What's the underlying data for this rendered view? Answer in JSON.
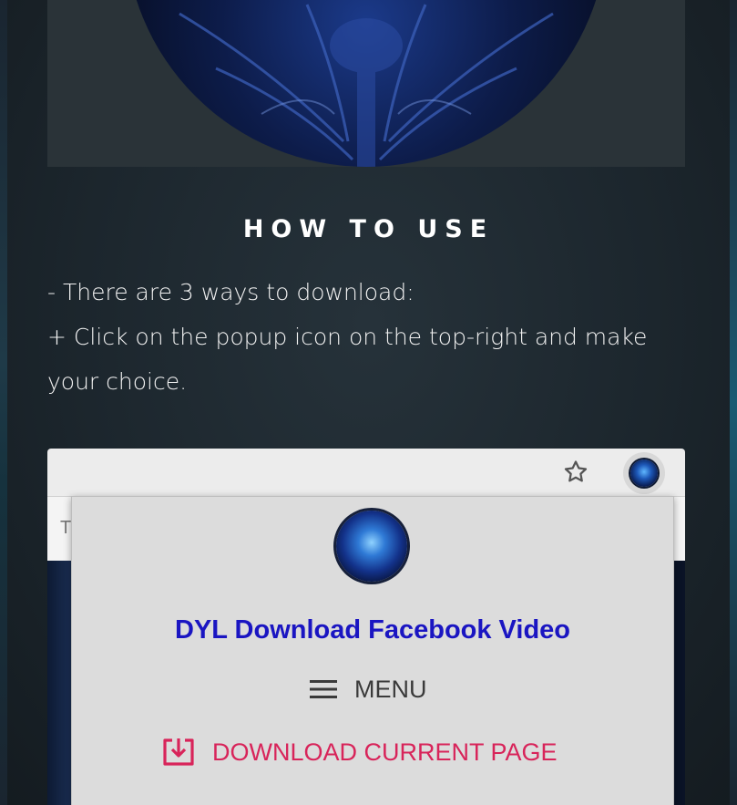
{
  "section": {
    "heading": "HOW TO USE",
    "intro_line": "- There are 3 ways to download:",
    "step_line": "+ Click on the popup icon on the top-right and make your choice."
  },
  "screenshot": {
    "tab_fragment": "T",
    "toolbar": {
      "bookmark_icon": "star-icon",
      "extension_icon": "extension-avatar-icon"
    },
    "popup": {
      "title": "DYL Download Facebook Video",
      "menu_label": "MENU",
      "download_label": "DOWNLOAD CURRENT PAGE"
    }
  },
  "colors": {
    "popup_title": "#1a15c2",
    "download_accent": "#d8245a",
    "page_background": "#1c262d"
  }
}
